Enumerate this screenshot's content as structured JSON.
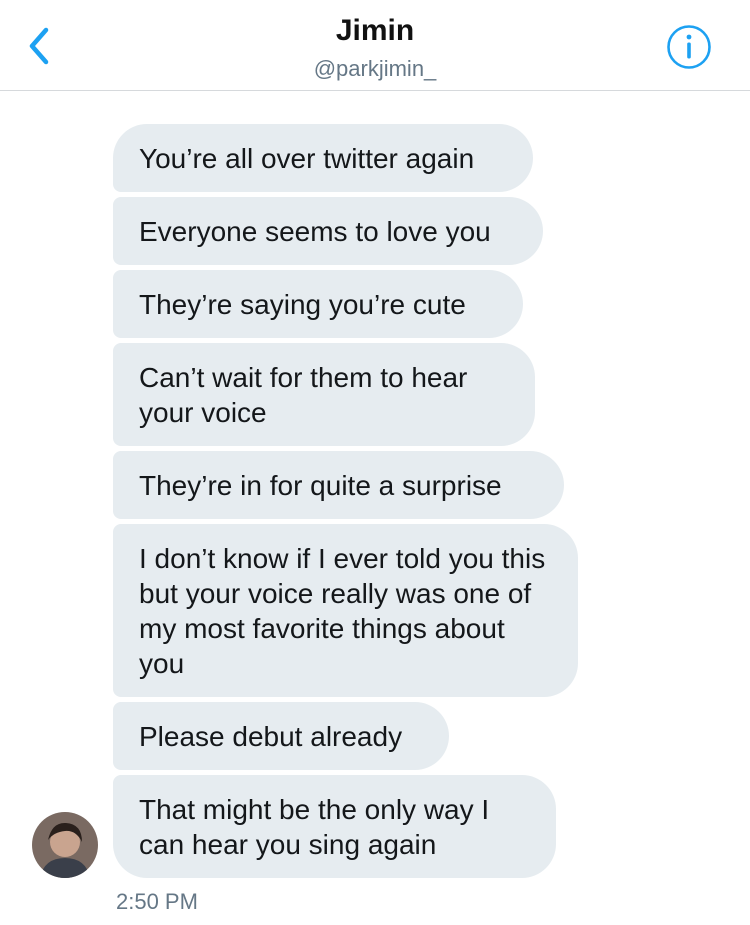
{
  "header": {
    "title": "Jimin",
    "handle": "@parkjimin_",
    "back_icon": "chevron-left-icon",
    "info_icon": "info-icon",
    "accent_color": "#1da1f2"
  },
  "messages": [
    {
      "text": "You’re all over twitter again"
    },
    {
      "text": "Everyone seems to love you"
    },
    {
      "text": "They’re saying you’re cute"
    },
    {
      "text": "Can’t wait for them to hear your voice"
    },
    {
      "text": "They’re in for quite a surprise"
    },
    {
      "text": "I don’t know if I ever told you this but your voice really was one of my most favorite things about you"
    },
    {
      "text": "Please debut already"
    },
    {
      "text": "That might be the only way I can hear you sing again"
    }
  ],
  "timestamp": "2:50 PM",
  "colors": {
    "bubble_bg": "#e6ecf0",
    "secondary_text": "#657786"
  }
}
